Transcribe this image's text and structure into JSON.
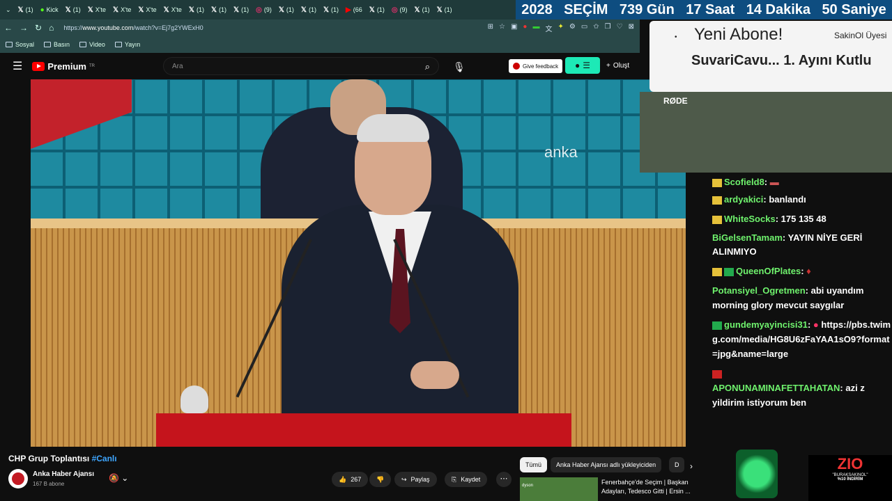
{
  "browser": {
    "tabs": [
      {
        "label": "(1)",
        "icon": "x-icon"
      },
      {
        "label": "Kick",
        "icon": "kick-icon"
      },
      {
        "label": "(1)",
        "icon": "x-icon"
      },
      {
        "label": "X'te",
        "icon": "x-icon"
      },
      {
        "label": "X'te",
        "icon": "x-icon"
      },
      {
        "label": "X'te",
        "icon": "x-icon"
      },
      {
        "label": "X'te",
        "icon": "x-icon"
      },
      {
        "label": "(1)",
        "icon": "x-icon"
      },
      {
        "label": "(1)",
        "icon": "x-icon"
      },
      {
        "label": "(1)",
        "icon": "x-icon"
      },
      {
        "label": "(9)",
        "icon": "instagram-icon"
      },
      {
        "label": "(1)",
        "icon": "x-icon"
      },
      {
        "label": "(1)",
        "icon": "x-icon"
      },
      {
        "label": "(1)",
        "icon": "x-icon"
      },
      {
        "label": "(66",
        "icon": "youtube-icon"
      },
      {
        "label": "(1)",
        "icon": "x-icon"
      },
      {
        "label": "(9)",
        "icon": "instagram-icon"
      },
      {
        "label": "(1)",
        "icon": "x-icon"
      },
      {
        "label": "(1)",
        "icon": "x-icon"
      }
    ],
    "url_prefix": "https://",
    "url_host": "www.youtube.com",
    "url_path": "/watch?v=Ej7g2YWExH0",
    "bookmarks": [
      "Sosyal",
      "Basın",
      "Video",
      "Yayın"
    ]
  },
  "countdown": {
    "year": "2028",
    "label": "SEÇİM",
    "days": "739 Gün",
    "hours": "17 Saat",
    "minutes": "14 Dakika",
    "seconds": "50 Saniye"
  },
  "youtube": {
    "logo_text": "Premium",
    "logo_region": "TR",
    "search_placeholder": "Ara",
    "feedback_label": "Give feedback",
    "create_label": "Oluşt",
    "video_watermark": "anka",
    "video_title": "CHP Grup Toplantısı",
    "video_hashtag": "#Canlı",
    "channel_name": "Anka Haber Ajansı",
    "subscribers": "167 B abone",
    "likes": "267",
    "share_label": "Paylaş",
    "save_label": "Kaydet",
    "chips": [
      "Tümü",
      "Anka Haber Ajansı adlı yükleyiciden",
      "D"
    ],
    "recommended_title": "Fenerbahçe'de Seçim | Başkan Adayları, Tedesco Gitti | Ersin ...",
    "recommended_thumb_text": "dyson"
  },
  "stream": {
    "alert_title": "Yeni Abone!",
    "alert_side": "SakinOl Üyesi",
    "alert_sub": "SuvariCavu... 1. Ayını Kutlu",
    "webcam_brand": "RØDE",
    "sponsor_brand": "ZIO",
    "sponsor_line1": "\"BURAKSAKINOL\"",
    "sponsor_line2": "%10 İNDİRİM"
  },
  "chat": [
    {
      "user": "Scofield8",
      "text": "",
      "badge": "y",
      "color": "green"
    },
    {
      "user": "ardyakici",
      "text": "banlandı",
      "badge": "y",
      "color": "green"
    },
    {
      "user": "WhiteSocks",
      "text": "175 135 48",
      "badge": "y",
      "color": "green"
    },
    {
      "user": "BiGelsenTamam",
      "text": "YAYIN NİYE GERİ ALINMIYO",
      "badge": "",
      "color": "green"
    },
    {
      "user": "QueenOfPlates",
      "text": "",
      "badge": "y",
      "color": "green"
    },
    {
      "user": "Potansiyel_Ogretmen",
      "text": "abi uyandım morning glory mevcut saygılar",
      "badge": "",
      "color": "green"
    },
    {
      "user": "gundemyayincisi31",
      "text": "https://pbs.twimg.com/media/HG8U6zFaYAA1sO9?format=jpg&name=large",
      "badge": "g",
      "color": "green"
    },
    {
      "user": "APONUNAMINAFETTAHATAN",
      "text": "azi z yildirim istiyorum ben",
      "badge": "r",
      "color": "green"
    }
  ]
}
